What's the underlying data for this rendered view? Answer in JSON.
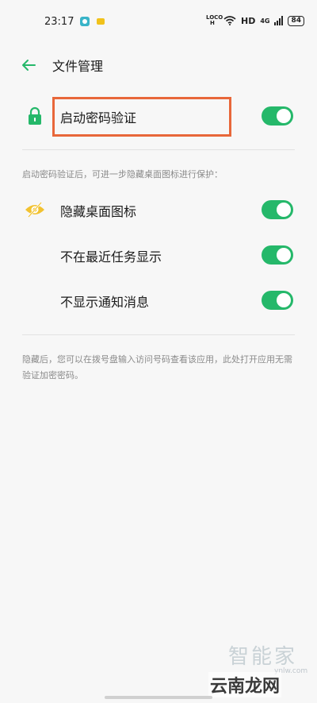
{
  "status_bar": {
    "time": "23:17",
    "loco_top": "LOCO",
    "loco_bottom": "H",
    "hd": "HD",
    "network": "4G",
    "battery": "84"
  },
  "header": {
    "title": "文件管理"
  },
  "password_row": {
    "label": "启动密码验证",
    "enabled": true
  },
  "protect_intro": "启动密码验证后，可进一步隐藏桌面图标进行保护：",
  "options": [
    {
      "label": "隐藏桌面图标",
      "enabled": true
    },
    {
      "label": "不在最近任务显示",
      "enabled": true
    },
    {
      "label": "不显示通知消息",
      "enabled": true
    }
  ],
  "footer_note": "隐藏后，您可以在拨号盘输入访问号码查看该应用，此处打开应用无需验证加密密码。",
  "watermark": {
    "top": "智能家",
    "bottom": "云南龙网",
    "url": "ynlw.com"
  },
  "colors": {
    "accent": "#25b86a",
    "highlight": "#e8673a",
    "eye_icon": "#f2c230",
    "background": "#f7f7f7"
  }
}
